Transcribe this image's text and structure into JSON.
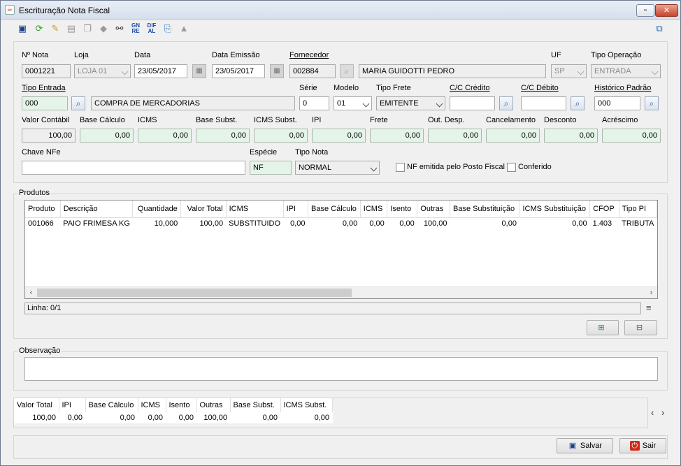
{
  "window": {
    "title": "Escrituração Nota Fiscal"
  },
  "toolbar": {
    "icons": [
      "save-icon",
      "refresh-icon",
      "edit-icon",
      "print-icon",
      "copy-icon",
      "tag-icon",
      "binoculars-icon",
      "gnre-icon",
      "difal-icon",
      "export-icon",
      "warning-icon"
    ],
    "gnre_line1": "GN",
    "gnre_line2": "RE",
    "difal_line1": "DIF",
    "difal_line2": "AL"
  },
  "header": {
    "nota_label": "Nº Nota",
    "nota_value": "0001221",
    "loja_label": "Loja",
    "loja_value": "LOJA 01",
    "data_label": "Data",
    "data_value": "23/05/2017",
    "emissao_label": "Data Emissão",
    "emissao_value": "23/05/2017",
    "fornecedor_label": "Fornecedor",
    "fornecedor_code": "002884",
    "fornecedor_name": "MARIA GUIDOTTI PEDRO",
    "uf_label": "UF",
    "uf_value": "SP",
    "tipo_operacao_label": "Tipo Operação",
    "tipo_operacao_value": "ENTRADA",
    "tipo_entrada_label": "Tipo Entrada",
    "tipo_entrada_code": "000",
    "tipo_entrada_desc": "COMPRA DE MERCADORIAS",
    "serie_label": "Série",
    "serie_value": "0",
    "modelo_label": "Modelo",
    "modelo_value": "01",
    "tipo_frete_label": "Tipo Frete",
    "tipo_frete_value": "EMITENTE",
    "cc_credito_label": "C/C Crédito",
    "cc_credito_value": "",
    "cc_debito_label": "C/C Débito",
    "cc_debito_value": "",
    "historico_label": "Histórico Padrão",
    "historico_value": "000",
    "chave_label": "Chave NFe",
    "chave_value": "",
    "especie_label": "Espécie",
    "especie_value": "NF",
    "tipo_nota_label": "Tipo Nota",
    "tipo_nota_value": "NORMAL",
    "nf_posto_label": "NF emitida pelo Posto Fiscal",
    "conferido_label": "Conferido"
  },
  "values": [
    {
      "label": "Valor Contábil",
      "value": "100,00"
    },
    {
      "label": "Base Cálculo",
      "value": "0,00"
    },
    {
      "label": "ICMS",
      "value": "0,00"
    },
    {
      "label": "Base Subst.",
      "value": "0,00"
    },
    {
      "label": "ICMS Subst.",
      "value": "0,00"
    },
    {
      "label": "IPI",
      "value": "0,00"
    },
    {
      "label": "Frete",
      "value": "0,00"
    },
    {
      "label": "Out. Desp.",
      "value": "0,00"
    },
    {
      "label": "Cancelamento",
      "value": "0,00"
    },
    {
      "label": "Desconto",
      "value": "0,00"
    },
    {
      "label": "Acréscimo",
      "value": "0,00"
    }
  ],
  "produtos": {
    "legend": "Produtos",
    "columns": [
      "Produto",
      "Descrição",
      "Quantidade",
      "Valor Total",
      "ICMS",
      "IPI",
      "Base Cálculo",
      "ICMS",
      "Isento",
      "Outras",
      "Base Substituição",
      "ICMS Substituição",
      "CFOP",
      "Tipo PI"
    ],
    "rows": [
      [
        "001066",
        "PAIO FRIMESA KG",
        "10,000",
        "100,00",
        "SUBSTITUIDO",
        "0,00",
        "0,00",
        "0,00",
        "0,00",
        "100,00",
        "0,00",
        "0,00",
        "1.403",
        "TRIBUTA"
      ]
    ],
    "status": "Linha: 0/1"
  },
  "observacao": {
    "legend": "Observação",
    "value": ""
  },
  "totais": {
    "columns": [
      "Valor Total",
      "IPI",
      "Base Cálculo",
      "ICMS",
      "Isento",
      "Outras",
      "Base Subst.",
      "ICMS Subst."
    ],
    "values": [
      "100,00",
      "0,00",
      "0,00",
      "0,00",
      "0,00",
      "100,00",
      "0,00",
      "0,00"
    ]
  },
  "footer": {
    "salvar_label": "Salvar",
    "sair_label": "Sair"
  }
}
